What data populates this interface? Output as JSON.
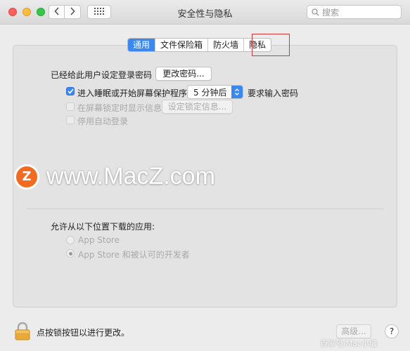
{
  "window": {
    "title": "安全性与隐私"
  },
  "search": {
    "placeholder": "搜索"
  },
  "tabs": [
    {
      "label": "通用",
      "active": true
    },
    {
      "label": "文件保险箱",
      "active": false
    },
    {
      "label": "防火墙",
      "active": false
    },
    {
      "label": "隐私",
      "active": false
    }
  ],
  "general": {
    "password_set_label": "已经给此用户设定登录密码",
    "change_password_button": "更改密码...",
    "require_password": {
      "checked": true,
      "label": "进入睡眠或开始屏幕保护程序",
      "delay_value": "5 分钟后",
      "suffix": "要求输入密码"
    },
    "show_message": {
      "checked": false,
      "label": "在屏幕锁定时显示信息",
      "button": "设定锁定信息..."
    },
    "disable_autologin": {
      "checked": false,
      "label": "停用自动登录"
    }
  },
  "downloads": {
    "heading": "允许从以下位置下载的应用:",
    "options": [
      {
        "label": "App Store",
        "selected": false
      },
      {
        "label": "App Store 和被认可的开发者",
        "selected": true
      }
    ]
  },
  "footer": {
    "lock_text": "点按锁按钮以进行更改。",
    "advanced_button": "高级...",
    "help_button": "?"
  },
  "watermark": {
    "logo_letter": "Z",
    "text": "www.MacZ.com",
    "corner_text": "百家号/Mac小编"
  },
  "colors": {
    "accent": "#3b89f0",
    "highlight_box": "#d43a3a",
    "watermark_logo": "#f26b21"
  }
}
